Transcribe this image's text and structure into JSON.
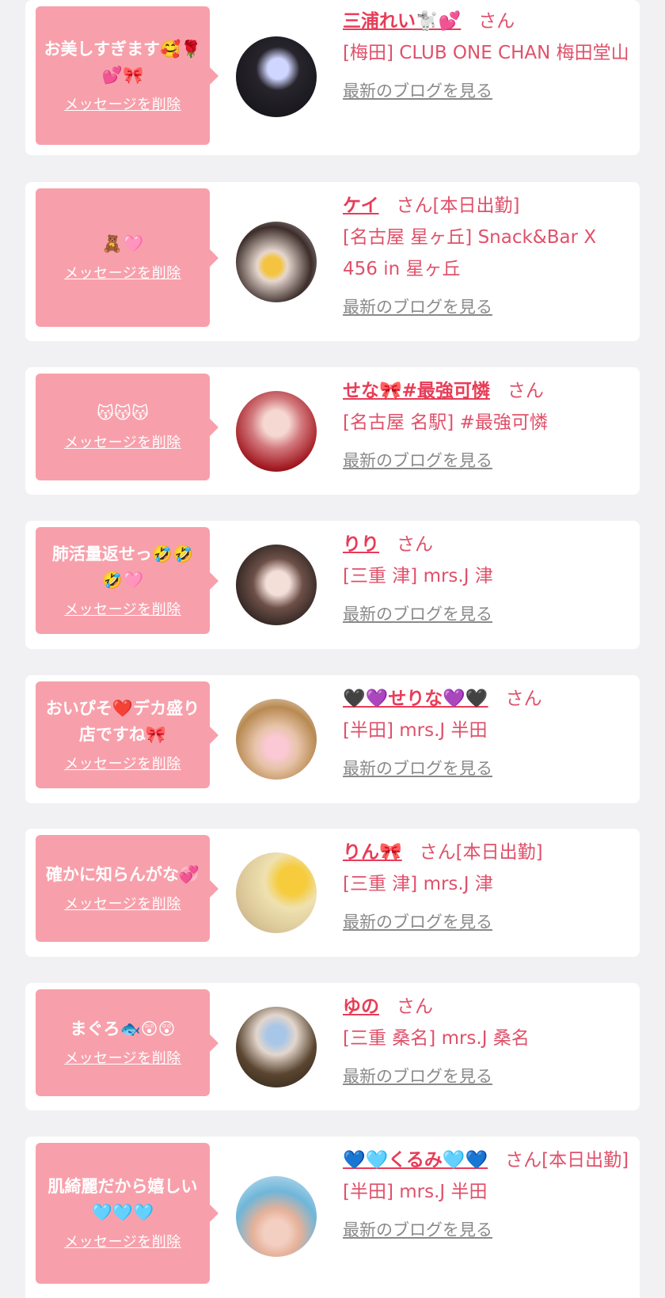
{
  "items": [
    {
      "message": "お美しすぎます🥰🌹💕🎀",
      "delete_label": "メッセージを削除",
      "name": "三浦れい🐩💕",
      "honorific": "さん",
      "status": "",
      "shop": "[梅田] CLUB ONE CHAN 梅田堂山",
      "blog_label": "最新のブログを見る"
    },
    {
      "message": "🧸🩷",
      "delete_label": "メッセージを削除",
      "name": "ケイ",
      "honorific": "さん",
      "status": "[本日出勤]",
      "shop": "[名古屋 星ヶ丘] Snack&Bar X 456 in 星ヶ丘",
      "blog_label": "最新のブログを見る"
    },
    {
      "message": "😽😽😽",
      "delete_label": "メッセージを削除",
      "name": "せな🎀#最強可憐",
      "honorific": "さん",
      "status": "",
      "shop": "[名古屋 名駅] #最強可憐",
      "blog_label": "最新のブログを見る"
    },
    {
      "message": "肺活量返せっ🤣🤣🤣🩷",
      "delete_label": "メッセージを削除",
      "name": "りり",
      "honorific": "さん",
      "status": "",
      "shop": "[三重 津] mrs.J 津",
      "blog_label": "最新のブログを見る"
    },
    {
      "message": "おいぴそ❤️デカ盛り店ですね🎀",
      "delete_label": "メッセージを削除",
      "name": "🖤💜せりな💜🖤",
      "honorific": "さん",
      "status": "",
      "shop": "[半田] mrs.J 半田",
      "blog_label": "最新のブログを見る"
    },
    {
      "message": "確かに知らんがな💞",
      "delete_label": "メッセージを削除",
      "name": "りん🎀",
      "honorific": "さん",
      "status": "[本日出勤]",
      "shop": "[三重 津] mrs.J 津",
      "blog_label": "最新のブログを見る"
    },
    {
      "message": "まぐろ🐟😲😲",
      "delete_label": "メッセージを削除",
      "name": "ゆの",
      "honorific": "さん",
      "status": "",
      "shop": "[三重 桑名] mrs.J 桑名",
      "blog_label": "最新のブログを見る"
    },
    {
      "message": "肌綺麗だから嬉しい🩵🩵🩵",
      "delete_label": "メッセージを削除",
      "name": "💙🩵くるみ🩵💙",
      "honorific": "さん",
      "status": "[本日出勤]",
      "shop": "[半田] mrs.J 半田",
      "blog_label": "最新のブログを見る"
    }
  ]
}
